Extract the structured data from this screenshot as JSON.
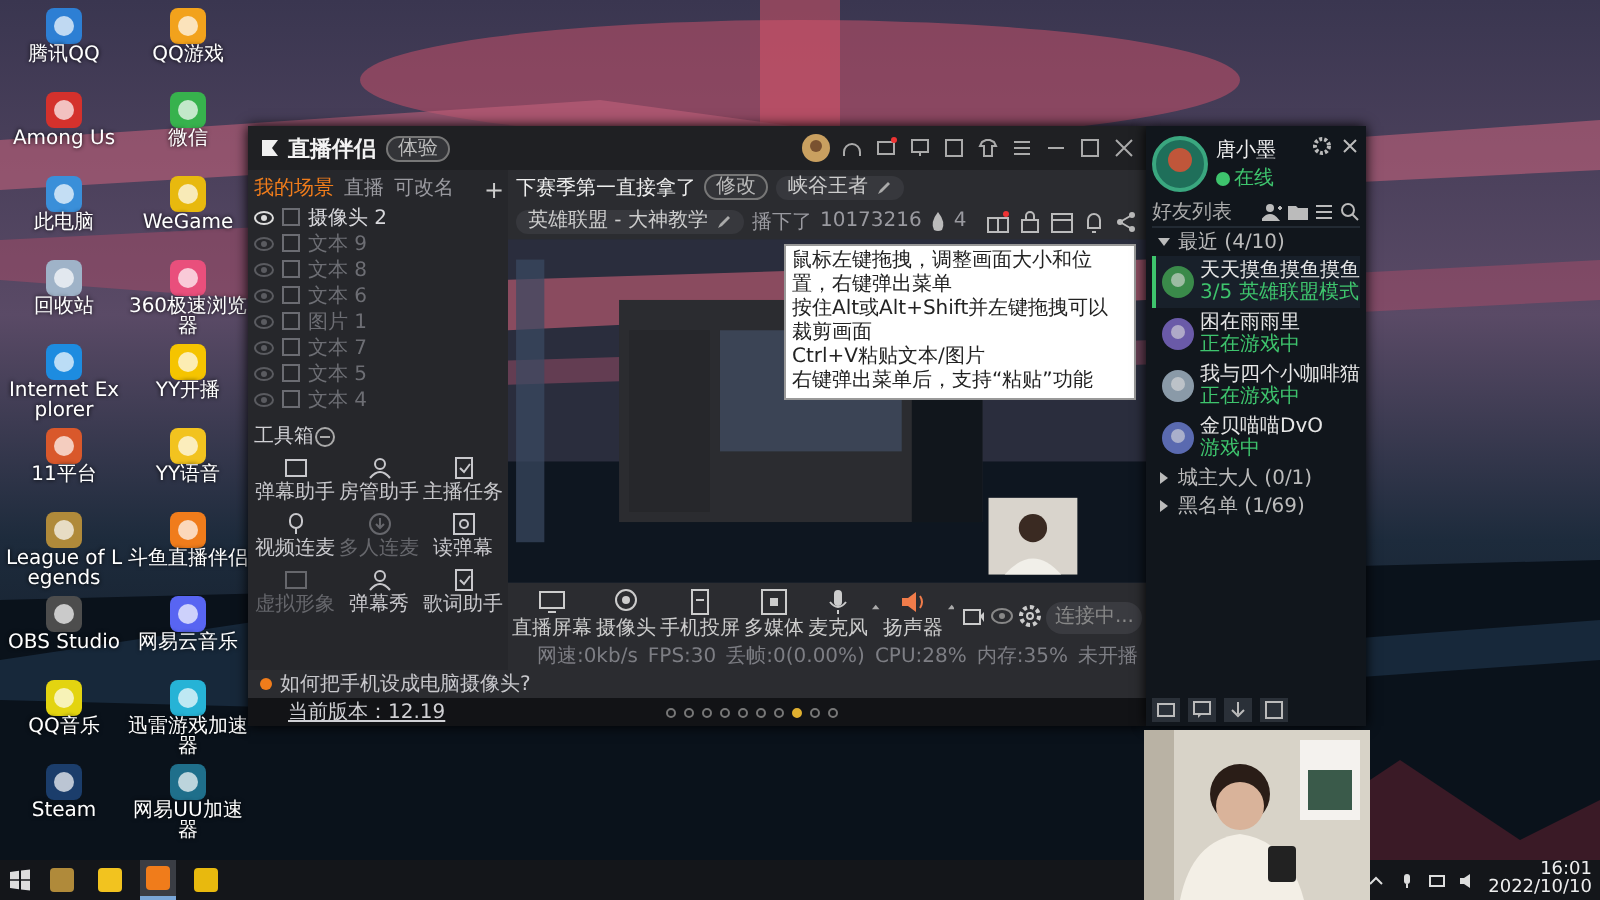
{
  "desktop_icons": [
    {
      "label": "腾讯QQ"
    },
    {
      "label": "QQ游戏"
    },
    {
      "label": "Among Us"
    },
    {
      "label": "微信"
    },
    {
      "label": "此电脑"
    },
    {
      "label": "WeGame"
    },
    {
      "label": "回收站"
    },
    {
      "label": "360极速浏览器"
    },
    {
      "label": "Internet Explorer"
    },
    {
      "label": "YY开播"
    },
    {
      "label": "11平台"
    },
    {
      "label": "YY语音"
    },
    {
      "label": "League of Legends"
    },
    {
      "label": "斗鱼直播伴侣"
    },
    {
      "label": "OBS Studio"
    },
    {
      "label": "网易云音乐"
    },
    {
      "label": "QQ音乐"
    },
    {
      "label": "迅雷游戏加速器"
    },
    {
      "label": "Steam"
    },
    {
      "label": "网易UU加速器"
    }
  ],
  "app": {
    "logo": "直播伴侣",
    "badge": "体验",
    "scene_tabs": [
      {
        "label": "我的场景",
        "selected": true
      },
      {
        "label": "直播",
        "selected": false
      },
      {
        "label": "可改名",
        "selected": false
      }
    ],
    "add_tab": "+",
    "scenes": [
      {
        "label": "摄像头 2",
        "visible": true
      },
      {
        "label": "文本 9",
        "visible": false
      },
      {
        "label": "文本 8",
        "visible": false
      },
      {
        "label": "文本 6",
        "visible": false
      },
      {
        "label": "图片 1",
        "visible": false
      },
      {
        "label": "文本 7",
        "visible": false
      },
      {
        "label": "文本 5",
        "visible": false
      },
      {
        "label": "文本 4",
        "visible": false
      }
    ],
    "toolbox_title": "工具箱",
    "tools": [
      {
        "label": "弹幕助手",
        "disabled": false
      },
      {
        "label": "房管助手",
        "disabled": false
      },
      {
        "label": "主播任务",
        "disabled": false
      },
      {
        "label": "视频连麦",
        "disabled": false
      },
      {
        "label": "多人连麦",
        "disabled": true
      },
      {
        "label": "读弹幕",
        "disabled": false
      },
      {
        "label": "虚拟形象",
        "disabled": true
      },
      {
        "label": "弹幕秀",
        "disabled": false
      },
      {
        "label": "歌词助手",
        "disabled": false
      }
    ],
    "stream_title": "下赛季第一直接拿了",
    "edit_button": "修改",
    "tag": "峡谷王者",
    "category": "英雄联盟 - 大神教学",
    "status": "播下了",
    "room_id": "10173216",
    "heat": "4",
    "controls": [
      {
        "label": "直播屏幕"
      },
      {
        "label": "摄像头"
      },
      {
        "label": "手机投屏"
      },
      {
        "label": "多媒体"
      },
      {
        "label": "麦克风"
      },
      {
        "label": "扬声器"
      }
    ],
    "connect_button": "连接中...",
    "stats": [
      "网速:0kb/s",
      "FPS:30",
      "丢帧:0(0.00%)",
      "CPU:28%",
      "内存:35%",
      "未开播"
    ],
    "tip": "如何把手机设成电脑摄像头?",
    "version": "当前版本：12.19",
    "page_dots": [
      {
        "selected": false
      },
      {
        "selected": false
      },
      {
        "selected": false
      },
      {
        "selected": false
      },
      {
        "selected": false
      },
      {
        "selected": false
      },
      {
        "selected": false
      },
      {
        "selected": true
      },
      {
        "selected": false
      },
      {
        "selected": false
      }
    ]
  },
  "tooltip": {
    "lines": [
      "鼠标左键拖拽，调整画面大小和位置，右键弹出菜单",
      "按住Alt或Alt+Shift并左键拖拽可以裁剪画面",
      "Ctrl+V粘贴文本/图片",
      "右键弹出菜单后，支持“粘贴”功能"
    ]
  },
  "friends": {
    "name": "唐小墨",
    "presence": "在线",
    "list_title": "好友列表",
    "groups": [
      {
        "label": "最近 (4/10)",
        "expanded": true,
        "friends": [
          {
            "name": "天天摸鱼摸鱼摸鱼",
            "activity": "3/5 英雄联盟模式",
            "selected": true
          },
          {
            "name": "困在雨雨里",
            "activity": "正在游戏中",
            "selected": false
          },
          {
            "name": "我与四个小咖啡猫",
            "activity": "正在游戏中",
            "selected": false
          },
          {
            "name": "金贝喵喵DvO",
            "activity": "游戏中",
            "selected": false
          }
        ]
      },
      {
        "label": "城主大人 (0/1)",
        "expanded": false
      },
      {
        "label": "黑名单 (1/69)",
        "expanded": false
      }
    ]
  },
  "taskbar": {
    "apps": [
      {
        "active": false
      },
      {
        "active": false
      },
      {
        "active": true
      },
      {
        "active": false
      }
    ],
    "time": "16:01",
    "date": "2022/10/10"
  }
}
